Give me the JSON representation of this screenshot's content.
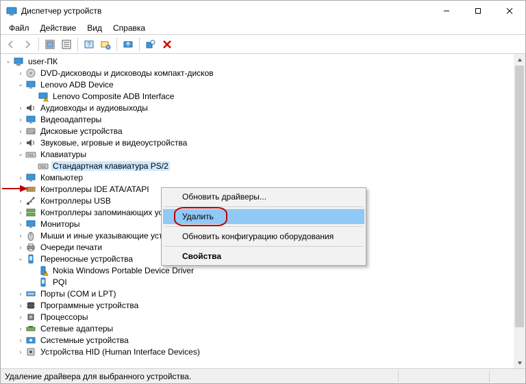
{
  "window": {
    "title": "Диспетчер устройств"
  },
  "menu": {
    "file": "Файл",
    "action": "Действие",
    "view": "Вид",
    "help": "Справка"
  },
  "tree": {
    "root": "user-ПК",
    "items": [
      {
        "label": "DVD-дисководы и дисководы компакт-дисков",
        "exp": ">",
        "icon": "disc"
      },
      {
        "label": "Lenovo ADB Device",
        "exp": "v",
        "icon": "monitor"
      },
      {
        "label": "Lenovo Composite ADB Interface",
        "exp": "",
        "icon": "monitor-warn",
        "depth": 2
      },
      {
        "label": "Аудиовходы и аудиовыходы",
        "exp": ">",
        "icon": "audio"
      },
      {
        "label": "Видеоадаптеры",
        "exp": ">",
        "icon": "monitor"
      },
      {
        "label": "Дисковые устройства",
        "exp": ">",
        "icon": "disk"
      },
      {
        "label": "Звуковые, игровые и видеоустройства",
        "exp": ">",
        "icon": "audio"
      },
      {
        "label": "Клавиатуры",
        "exp": "v",
        "icon": "keyboard"
      },
      {
        "label": "Стандартная клавиатура PS/2",
        "exp": "",
        "icon": "keyboard",
        "depth": 2,
        "selected": true
      },
      {
        "label": "Компьютер",
        "exp": ">",
        "icon": "monitor"
      },
      {
        "label": "Контроллеры IDE ATA/ATAPI",
        "exp": ">",
        "icon": "ide"
      },
      {
        "label": "Контроллеры USB",
        "exp": ">",
        "icon": "usb"
      },
      {
        "label": "Контроллеры запоминающих устройств",
        "exp": ">",
        "icon": "storage"
      },
      {
        "label": "Мониторы",
        "exp": ">",
        "icon": "monitor"
      },
      {
        "label": "Мыши и иные указывающие устройства",
        "exp": ">",
        "icon": "mouse"
      },
      {
        "label": "Очереди печати",
        "exp": ">",
        "icon": "printer"
      },
      {
        "label": "Переносные устройства",
        "exp": "v",
        "icon": "portable"
      },
      {
        "label": "Nokia Windows Portable Device Driver",
        "exp": "",
        "icon": "portable-warn",
        "depth": 2
      },
      {
        "label": "PQI",
        "exp": "",
        "icon": "portable",
        "depth": 2
      },
      {
        "label": "Порты (COM и LPT)",
        "exp": ">",
        "icon": "port"
      },
      {
        "label": "Программные устройства",
        "exp": ">",
        "icon": "chip"
      },
      {
        "label": "Процессоры",
        "exp": ">",
        "icon": "cpu"
      },
      {
        "label": "Сетевые адаптеры",
        "exp": ">",
        "icon": "net"
      },
      {
        "label": "Системные устройства",
        "exp": ">",
        "icon": "system"
      },
      {
        "label": "Устройства HID (Human Interface Devices)",
        "exp": ">",
        "icon": "hid"
      }
    ]
  },
  "context": {
    "update": "Обновить драйверы...",
    "delete": "Удалить",
    "refresh": "Обновить конфигурацию оборудования",
    "properties": "Свойства"
  },
  "status": "Удаление драйвера для выбранного устройства."
}
